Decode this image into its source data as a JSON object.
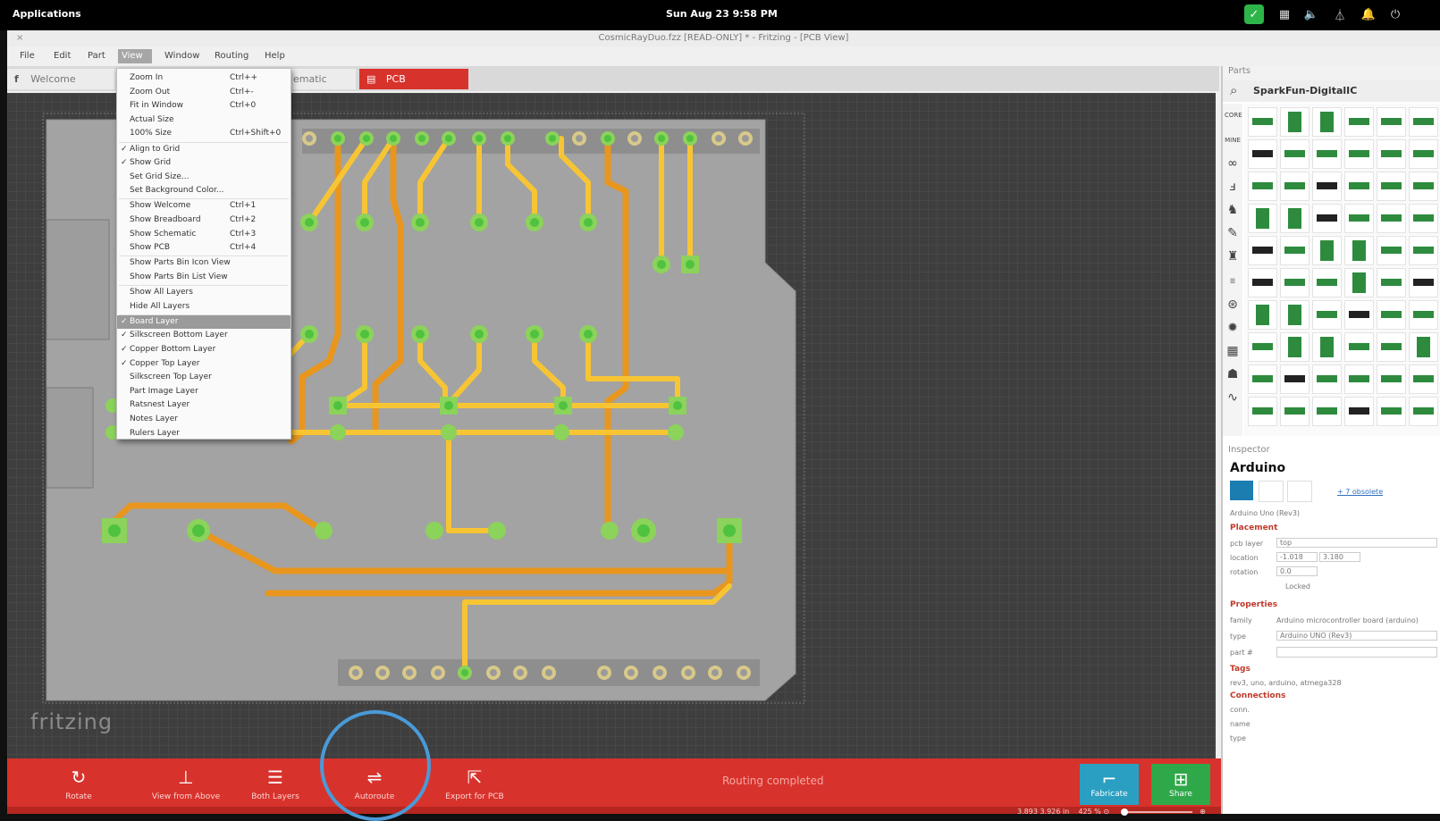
{
  "topbar": {
    "applications": "Applications",
    "clock": "Sun Aug 23  9:58 PM",
    "tray_icons": [
      "shield-check-icon",
      "keyboard-icon",
      "volume-icon",
      "network-icon",
      "bell-icon",
      "power-icon"
    ]
  },
  "window": {
    "title": "CosmicRayDuo.fzz [READ-ONLY] * - Fritzing - [PCB View]",
    "close_glyph": "×"
  },
  "menubar": {
    "items": [
      "File",
      "Edit",
      "Part",
      "View",
      "Window",
      "Routing",
      "Help"
    ],
    "active": "View"
  },
  "tabs": [
    {
      "label": "Welcome"
    },
    {
      "label": "ematic"
    },
    {
      "label": "PCB"
    }
  ],
  "view_menu": {
    "items": [
      {
        "label": "Zoom In",
        "shortcut": "Ctrl++",
        "checked": false
      },
      {
        "label": "Zoom Out",
        "shortcut": "Ctrl+-",
        "checked": false
      },
      {
        "label": "Fit in Window",
        "shortcut": "Ctrl+0",
        "checked": false
      },
      {
        "label": "Actual Size",
        "shortcut": "",
        "checked": false
      },
      {
        "label": "100% Size",
        "shortcut": "Ctrl+Shift+0",
        "checked": false
      },
      {
        "label": "Align to Grid",
        "shortcut": "",
        "checked": true
      },
      {
        "label": "Show Grid",
        "shortcut": "",
        "checked": true
      },
      {
        "label": "Set Grid Size...",
        "shortcut": "",
        "checked": false
      },
      {
        "label": "Set Background Color...",
        "shortcut": "",
        "checked": false
      },
      {
        "label": "Show Welcome",
        "shortcut": "Ctrl+1",
        "checked": false
      },
      {
        "label": "Show Breadboard",
        "shortcut": "Ctrl+2",
        "checked": false
      },
      {
        "label": "Show Schematic",
        "shortcut": "Ctrl+3",
        "checked": false
      },
      {
        "label": "Show PCB",
        "shortcut": "Ctrl+4",
        "checked": false
      },
      {
        "label": "Show Parts Bin Icon View",
        "shortcut": "",
        "checked": false
      },
      {
        "label": "Show Parts Bin List View",
        "shortcut": "",
        "checked": false
      },
      {
        "label": "Show All Layers",
        "shortcut": "",
        "checked": false
      },
      {
        "label": "Hide All Layers",
        "shortcut": "",
        "checked": false
      },
      {
        "label": "Board Layer",
        "shortcut": "",
        "checked": true,
        "highlighted": true
      },
      {
        "label": "Silkscreen Bottom Layer",
        "shortcut": "",
        "checked": true
      },
      {
        "label": "Copper Bottom Layer",
        "shortcut": "",
        "checked": true
      },
      {
        "label": "Copper Top Layer",
        "shortcut": "",
        "checked": true
      },
      {
        "label": "Silkscreen Top Layer",
        "shortcut": "",
        "checked": false
      },
      {
        "label": "Part Image Layer",
        "shortcut": "",
        "checked": false
      },
      {
        "label": "Ratsnest Layer",
        "shortcut": "",
        "checked": false
      },
      {
        "label": "Notes Layer",
        "shortcut": "",
        "checked": false
      },
      {
        "label": "Rulers Layer",
        "shortcut": "",
        "checked": false
      }
    ]
  },
  "canvas": {
    "watermark": "fritzing",
    "colors": {
      "board": "#a3a3a3",
      "trace_top": "#f7c533",
      "trace_bottom": "#e8961e",
      "pad": "#8bd35a",
      "pad_center": "#4fc23f",
      "header_pad": "#d8c98a"
    }
  },
  "toolbar": {
    "tools": [
      {
        "label": "Rotate",
        "icon": "rotate-icon"
      },
      {
        "label": "View from Above",
        "icon": "view-from-above-icon"
      },
      {
        "label": "Both Layers",
        "icon": "both-layers-icon"
      },
      {
        "label": "Autoroute",
        "icon": "autoroute-icon"
      },
      {
        "label": "Export for PCB",
        "icon": "export-icon"
      }
    ],
    "status": "Routing completed",
    "fabricate": "Fabricate",
    "share": "Share"
  },
  "statusbar": {
    "coords": "3.893 3.926 in",
    "zoom": "425 %"
  },
  "parts_panel": {
    "title": "Parts",
    "search_text": "SparkFun-DigitalIC",
    "bin_icons": [
      "core-icon",
      "mine-icon",
      "infinity-icon",
      "fritzing-bin-icon",
      "arduino-icon",
      "seeed-icon",
      "sparkfun-icon",
      "contrib-icon",
      "globe-icon",
      "gear-icon",
      "battery-icon",
      "mbed-icon",
      "analog-icon"
    ]
  },
  "inspector": {
    "title": "Inspector",
    "part_name": "Arduino",
    "link": "+ 7 obsolete",
    "subtitle": "Arduino Uno (Rev3)",
    "placement_label": "Placement",
    "pcb_layer_label": "pcb layer",
    "pcb_layer_value": "top",
    "location_label": "location",
    "location_x": "-1.018",
    "location_y": "3.180",
    "rotation_label": "rotation",
    "rotation_value": "0.0",
    "locked_label": "Locked",
    "properties_label": "Properties",
    "family_label": "family",
    "family_value": "Arduino microcontroller board (arduino)",
    "type_label": "type",
    "type_value": "Arduino UNO (Rev3)",
    "part_num_label": "part #",
    "tags_label": "Tags",
    "tags_value": "rev3, uno, arduino, atmega328",
    "connections_label": "Connections",
    "conn_label": "conn.",
    "name_label": "name",
    "type2_label": "type"
  }
}
